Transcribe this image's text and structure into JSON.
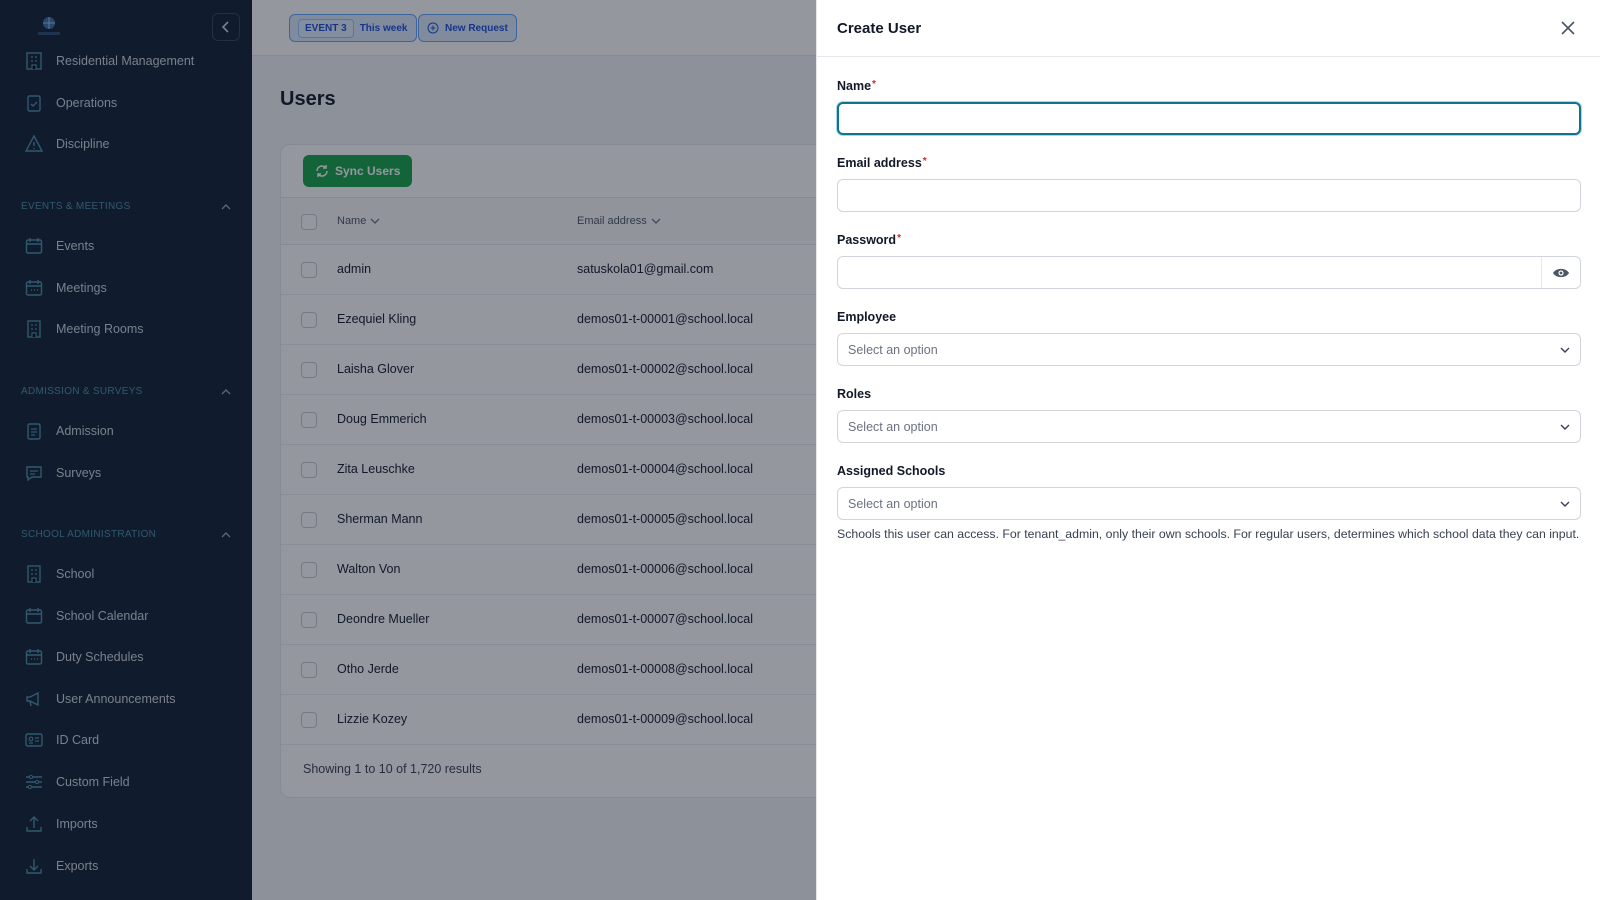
{
  "topbar": {
    "event_tag": "EVENT 3",
    "event_label": "This week",
    "new_request": "New Request"
  },
  "sidebar": {
    "items_top": [
      {
        "label": "Residential Management",
        "icon": "building-icon"
      },
      {
        "label": "Operations",
        "icon": "clipboard-check-icon"
      },
      {
        "label": "Discipline",
        "icon": "warning-icon"
      }
    ],
    "sections": [
      {
        "title": "EVENTS & MEETINGS",
        "items": [
          {
            "label": "Events",
            "icon": "calendar-icon"
          },
          {
            "label": "Meetings",
            "icon": "calendar-grid-icon"
          },
          {
            "label": "Meeting Rooms",
            "icon": "building-icon"
          }
        ]
      },
      {
        "title": "ADMISSION & SURVEYS",
        "items": [
          {
            "label": "Admission",
            "icon": "clipboard-icon"
          },
          {
            "label": "Surveys",
            "icon": "chat-icon"
          }
        ]
      },
      {
        "title": "SCHOOL ADMINISTRATION",
        "items": [
          {
            "label": "School",
            "icon": "building-icon"
          },
          {
            "label": "School Calendar",
            "icon": "calendar-icon"
          },
          {
            "label": "Duty Schedules",
            "icon": "calendar-grid-icon"
          },
          {
            "label": "User Announcements",
            "icon": "megaphone-icon"
          },
          {
            "label": "ID Card",
            "icon": "id-card-icon"
          },
          {
            "label": "Custom Field",
            "icon": "sliders-icon"
          },
          {
            "label": "Imports",
            "icon": "upload-icon"
          },
          {
            "label": "Exports",
            "icon": "download-icon"
          }
        ]
      }
    ]
  },
  "main": {
    "page_title": "Users",
    "sync_button": "Sync Users",
    "columns": {
      "name": "Name",
      "email": "Email address"
    },
    "rows": [
      {
        "name": "admin",
        "email": "satuskola01@gmail.com"
      },
      {
        "name": "Ezequiel Kling",
        "email": "demos01-t-00001@school.local"
      },
      {
        "name": "Laisha Glover",
        "email": "demos01-t-00002@school.local"
      },
      {
        "name": "Doug Emmerich",
        "email": "demos01-t-00003@school.local"
      },
      {
        "name": "Zita Leuschke",
        "email": "demos01-t-00004@school.local"
      },
      {
        "name": "Sherman Mann",
        "email": "demos01-t-00005@school.local"
      },
      {
        "name": "Walton Von",
        "email": "demos01-t-00006@school.local"
      },
      {
        "name": "Deondre Mueller",
        "email": "demos01-t-00007@school.local"
      },
      {
        "name": "Otho Jerde",
        "email": "demos01-t-00008@school.local"
      },
      {
        "name": "Lizzie Kozey",
        "email": "demos01-t-00009@school.local"
      }
    ],
    "footer": "Showing 1 to 10 of 1,720 results"
  },
  "drawer": {
    "title": "Create User",
    "fields": {
      "name": {
        "label": "Name",
        "value": ""
      },
      "email": {
        "label": "Email address",
        "value": ""
      },
      "password": {
        "label": "Password",
        "value": ""
      },
      "employee": {
        "label": "Employee",
        "placeholder": "Select an option"
      },
      "roles": {
        "label": "Roles",
        "placeholder": "Select an option"
      },
      "schools": {
        "label": "Assigned Schools",
        "placeholder": "Select an option"
      }
    },
    "help_text": "Schools this user can access. For tenant_admin, only their own schools. For regular users, determines which school data they can input."
  },
  "colors": {
    "sidebar_bg": "#0f1e33",
    "accent": "#0e7490",
    "success": "#16a34a",
    "required": "#dc2626"
  }
}
